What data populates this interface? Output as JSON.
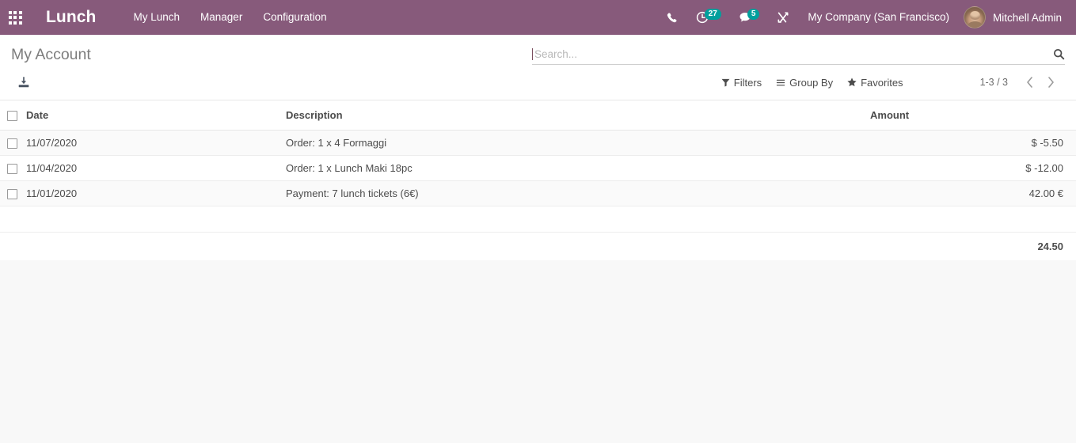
{
  "navbar": {
    "apps_icon": "apps-grid-icon",
    "brand": "Lunch",
    "menu_items": [
      {
        "label": "My Lunch",
        "name": "menu-my-lunch"
      },
      {
        "label": "Manager",
        "name": "menu-manager"
      },
      {
        "label": "Configuration",
        "name": "menu-configuration"
      }
    ],
    "phone_icon": "phone-icon",
    "activity": {
      "icon": "clock-activity-icon",
      "badge": "27"
    },
    "messaging": {
      "icon": "chat-bubble-icon",
      "badge": "5"
    },
    "tools_icon": "tools-icon",
    "company": "My Company (San Francisco)",
    "user": {
      "name": "Mitchell Admin",
      "avatar": "user-avatar"
    },
    "background_color": "#875A7B",
    "badge_color": "#00A09D"
  },
  "control_panel": {
    "breadcrumb": "My Account",
    "search": {
      "placeholder": "Search...",
      "value": "",
      "icon": "search-icon"
    },
    "export_icon": "download-export-icon",
    "filters": [
      {
        "label": "Filters",
        "icon": "filter-funnel-icon",
        "name": "filters-button"
      },
      {
        "label": "Group By",
        "icon": "group-by-lines-icon",
        "name": "group-by-button"
      },
      {
        "label": "Favorites",
        "icon": "star-icon",
        "name": "favorites-button"
      }
    ],
    "pager": {
      "count": "1-3 / 3",
      "prev_icon": "chevron-left-icon",
      "next_icon": "chevron-right-icon"
    }
  },
  "table": {
    "columns": {
      "date": "Date",
      "description": "Description",
      "amount": "Amount"
    },
    "rows": [
      {
        "date": "11/07/2020",
        "description": "Order: 1 x 4 Formaggi",
        "amount": "$ -5.50"
      },
      {
        "date": "11/04/2020",
        "description": "Order: 1 x Lunch Maki 18pc",
        "amount": "$ -12.00"
      },
      {
        "date": "11/01/2020",
        "description": "Payment: 7 lunch tickets (6€)",
        "amount": "42.00 €"
      }
    ],
    "total": "24.50"
  }
}
